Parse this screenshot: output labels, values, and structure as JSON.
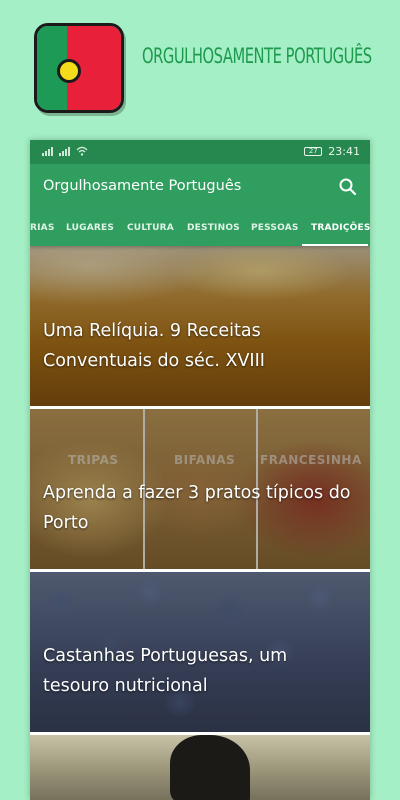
{
  "promo": {
    "title": "ORGULHOSAMENTE PORTUGUÊS",
    "colors": {
      "green": "#1d9a55",
      "red": "#e8203a",
      "yellow": "#f5dc1a",
      "background": "#a4efc5"
    }
  },
  "status_bar": {
    "battery": "27",
    "time": "23:41"
  },
  "toolbar": {
    "title": "Orgulhosamente Português",
    "search_icon": "search-icon"
  },
  "tabs": [
    {
      "label": "RIAS"
    },
    {
      "label": "LUGARES"
    },
    {
      "label": "CULTURA"
    },
    {
      "label": "DESTINOS"
    },
    {
      "label": "PESSOAS"
    },
    {
      "label": "TRADIÇÕES",
      "active": true
    }
  ],
  "articles": [
    {
      "title": "Uma Relíquia. 9 Receitas Conventuais do séc. XVIII"
    },
    {
      "title": "Aprenda a fazer 3 pratos típicos do Porto",
      "image_labels": [
        "TRIPAS",
        "BIFANAS",
        "FRANCESINHA"
      ]
    },
    {
      "title": "Castanhas Portuguesas, um tesouro nutricional"
    },
    {
      "title": ""
    }
  ],
  "colors": {
    "primary": "#2f9e5f",
    "status_bar": "#27884f"
  }
}
